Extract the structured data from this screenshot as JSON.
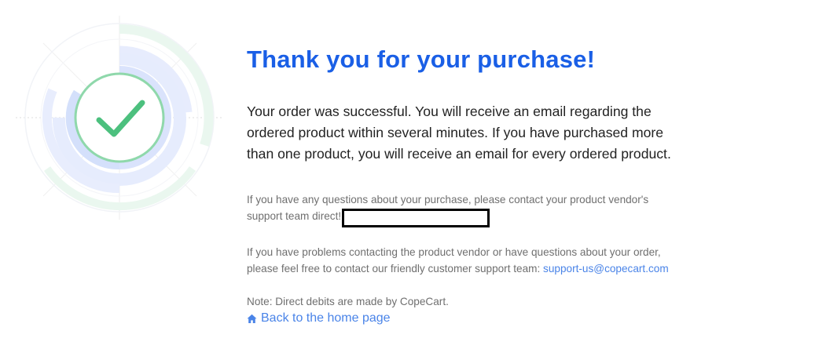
{
  "title": "Thank you for your purchase!",
  "lead": "Your order was successful. You will receive an email regarding the ordered product within several minutes. If you have purchased more than one product, you will receive an email for every ordered product.",
  "questions_text": "If you have any questions about your purchase, please contact your product vendor's support team direct!",
  "problems_text": "If you have problems contacting the product vendor or have questions about your order, please feel free to contact our friendly customer support team: ",
  "support_email": "support-us@copecart.com",
  "note_text": "Note: Direct debits are made by CopeCart.",
  "home_link": "Back to the home page",
  "colors": {
    "title": "#1a5fe6",
    "link": "#4a84e8",
    "check": "#4cc07e"
  },
  "icons": {
    "success": "checkmark-icon",
    "home": "home-icon"
  }
}
